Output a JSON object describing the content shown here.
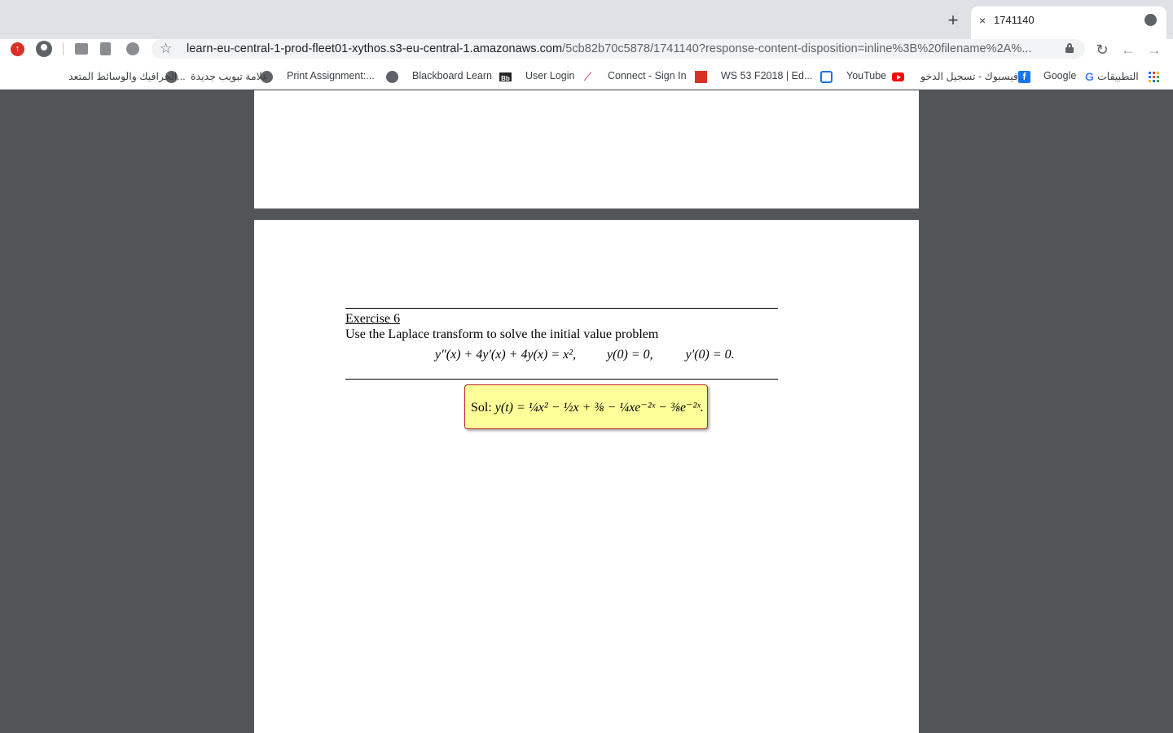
{
  "browser": {
    "tab": {
      "close_glyph": "×",
      "title": "1741140",
      "favicon": "globe-icon"
    },
    "new_tab_glyph": "+",
    "url": {
      "host": "learn-eu-central-1-prod-fleet01-xythos.s3-eu-central-1.amazonaws.com",
      "path": "/5cb82b70c5878/1741140?response-content-disposition=inline%3B%20filename%2A%..."
    },
    "toolbar_icons": [
      "reload-icon",
      "back-icon",
      "forward-icon",
      "star-icon",
      "lock-icon",
      "profile-icon"
    ]
  },
  "bookmarks": [
    {
      "label": "التطبيقات",
      "icon": "apps-grid-icon"
    },
    {
      "label": "Google",
      "icon": "google-icon"
    },
    {
      "label": "فيسبوك - تسجيل الدخو...",
      "icon": "facebook-icon"
    },
    {
      "label": "YouTube",
      "icon": "youtube-icon"
    },
    {
      "label": "WS 53 F2018 | Ed...",
      "icon": "webwork-icon"
    },
    {
      "label": "Connect - Sign In",
      "icon": "connect-icon"
    },
    {
      "label": "User Login",
      "icon": "feather-icon"
    },
    {
      "label": "Blackboard Learn",
      "icon": "blackboard-icon"
    },
    {
      "label": "Print Assignment:...",
      "icon": "globe-icon"
    },
    {
      "label": "علامة تبويب جديدة",
      "icon": "globe-icon"
    },
    {
      "label": "الجرافيك والوسائط المتعد...",
      "icon": "globe-icon"
    }
  ],
  "document": {
    "exercise_title": "Exercise 6",
    "exercise_text": "Use the Laplace transform to solve the initial value problem",
    "equation": "y″(x) + 4y′(x) + 4y(x) = x²,",
    "condition1": "y(0) = 0,",
    "condition2": "y′(0) = 0.",
    "solution_label": "Sol:",
    "solution_expr": "y(t) = ¼x² − ½x + ⅜ − ¼xe⁻²ˣ − ⅜e⁻²ˣ."
  },
  "colors": {
    "viewer_background": "#525659",
    "solution_fill": "#ffff99",
    "solution_border": "#c0272d"
  }
}
